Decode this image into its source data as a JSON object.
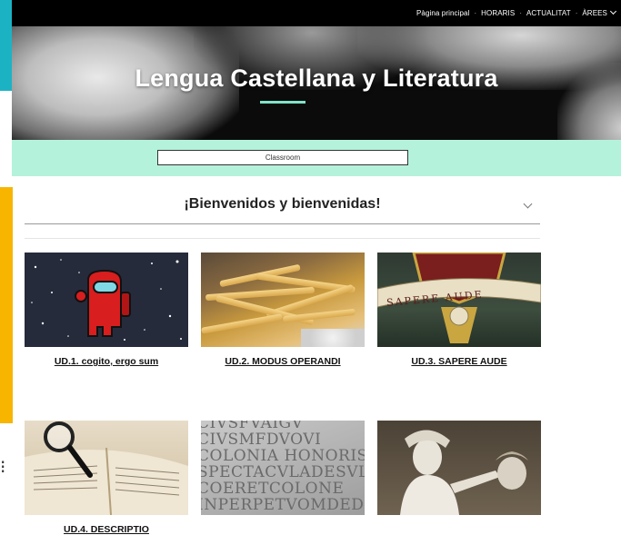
{
  "nav": {
    "items": [
      {
        "label": "Pàgina principal"
      },
      {
        "label": "HORARIS"
      },
      {
        "label": "ACTUALITAT"
      },
      {
        "label": "ÀREES"
      }
    ]
  },
  "hero": {
    "title": "Lengua Castellana y Literatura"
  },
  "band": {
    "button_label": "Classroom"
  },
  "welcome": {
    "title": "¡Bienvenidos y bienvenidas!"
  },
  "units": [
    {
      "label": "UD.1. cogito, ergo sum",
      "image": "among-us-space"
    },
    {
      "label": "UD.2. MODUS OPERANDI",
      "image": "french-fries"
    },
    {
      "label": "UD.3. SAPERE AUDE",
      "image": "crest-sapere-aude"
    },
    {
      "label": "UD.4. DESCRIPTIO",
      "image": "book-magnifier"
    },
    {
      "label": "",
      "image": "roman-inscription"
    },
    {
      "label": "",
      "image": "perseus-statue"
    }
  ],
  "images": {
    "crest_motto": "SAPERE AUDE",
    "inscription": "CIVSFVAIGV\nCIVSMFDVOVI\nCOLONIA HONORIS\nSPECTACVLADESVL\nCOERETCOLONE\nINPERPETVOMDED"
  },
  "colors": {
    "nav_bg": "#000000",
    "band": "#b5f2dc",
    "hero_accent": "#7fe3c9",
    "deco_teal": "#1bb3c4",
    "deco_yellow": "#f7b500"
  }
}
